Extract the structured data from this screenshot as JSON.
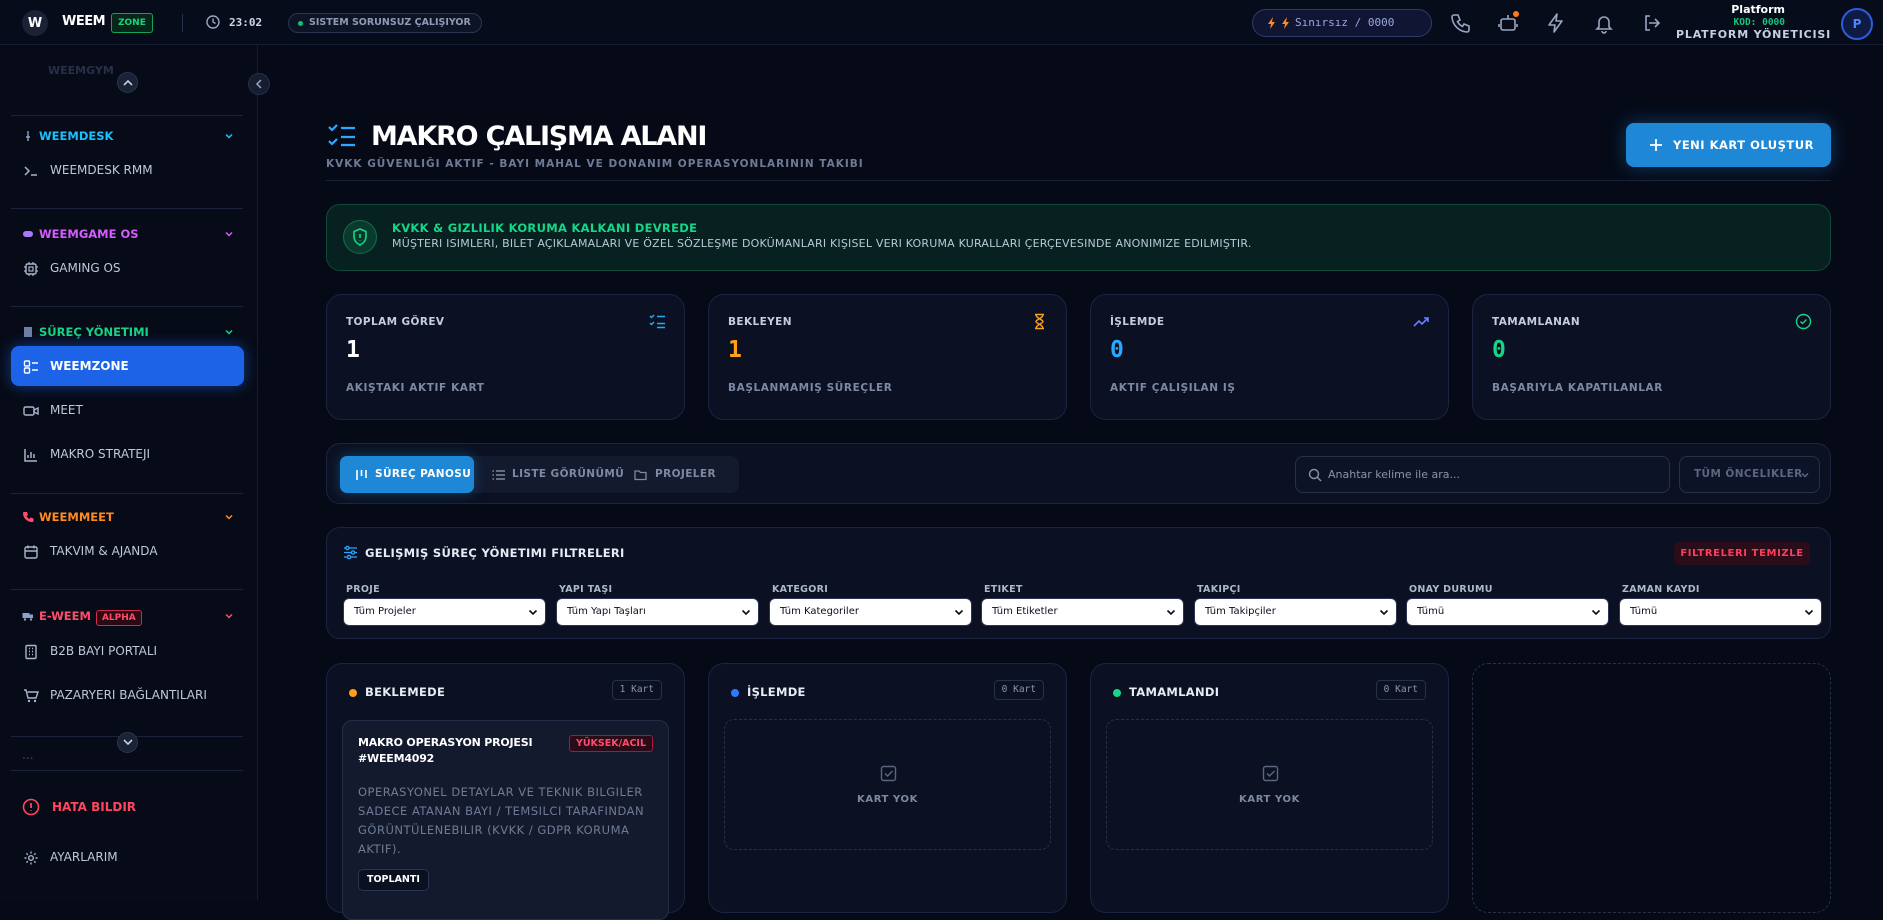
{
  "topbar": {
    "logo_letter": "W",
    "brand": "WEEM",
    "zone_tag": "ZONE",
    "time": "23:02",
    "system_status": "SISTEM SORUNSUZ ÇALIŞIYOR",
    "credit_text": "Sınırsız / 0000",
    "user_name": "Platform",
    "user_code": "KOD: 0000",
    "user_role": "PLATFORM YÖNETICISI",
    "avatar_letter": "P"
  },
  "sidebar": {
    "faded_top": "WEEMGYM",
    "sections": [
      {
        "label": "WEEMDESK",
        "color": "#19c2ff",
        "items": [
          {
            "label": "WEEMDESK RMM"
          }
        ]
      },
      {
        "label": "WEEMGAME OS",
        "color": "#d65cff",
        "items": [
          {
            "label": "GAMING OS"
          }
        ]
      },
      {
        "label": "SÜREÇ YÖNETIMI",
        "color": "#17d486",
        "items": [
          {
            "label": "WEEMZONE"
          },
          {
            "label": "MEET"
          },
          {
            "label": "MAKRO STRATEJI"
          }
        ]
      },
      {
        "label": "WEEMMEET",
        "color": "#ff8a1f",
        "items": [
          {
            "label": "TAKVIM & AJANDA"
          }
        ]
      },
      {
        "label": "E-WEEM",
        "color": "#ff4d6d",
        "badge": "ALPHA",
        "items": [
          {
            "label": "B2B BAYI PORTALI"
          },
          {
            "label": "PAZARYERI BAĞLANTILARI"
          }
        ]
      }
    ],
    "faded_bottom": "...",
    "report_bug": "HATA BILDIR",
    "settings": "AYARLARIM"
  },
  "page": {
    "title": "MAKRO ÇALIŞMA ALANI",
    "subtitle": "KVKK GÜVENLIĞI AKTIF - BAYI MAHAL VE DONANIM OPERASYONLARININ TAKIBI",
    "new_card_button": "YENI KART OLUŞTUR"
  },
  "kvkk": {
    "title": "KVKK & GIZLILIK KORUMA KALKANI DEVREDE",
    "text": "MÜŞTERI ISIMLERI, BILET AÇIKLAMALARI VE ÖZEL SÖZLEŞME DOKÜMANLARI KIŞISEL VERI KORUMA KURALLARI ÇERÇEVESINDE ANONIMIZE EDILMIŞTIR."
  },
  "stats": [
    {
      "label": "TOPLAM GÖREV",
      "value": "1",
      "caption": "AKIŞTAKI AKTIF KART",
      "color": "#ffffff",
      "icon": "list-check-icon"
    },
    {
      "label": "BEKLEYEN",
      "value": "1",
      "caption": "BAŞLANMAMIŞ SÜREÇLER",
      "color": "#ff9f1a",
      "icon": "hourglass-icon"
    },
    {
      "label": "İŞLEMDE",
      "value": "0",
      "caption": "AKTIF ÇALIŞILAN IŞ",
      "color": "#2aa8ff",
      "icon": "trend-up-icon"
    },
    {
      "label": "TAMAMLANAN",
      "value": "0",
      "caption": "BAŞARIYLA KAPATILANLAR",
      "color": "#17d486",
      "icon": "check-circle-icon"
    }
  ],
  "toolbar": {
    "tabs": [
      {
        "label": "SÜREÇ PANOSU"
      },
      {
        "label": "LISTE GÖRÜNÜMÜ"
      },
      {
        "label": "PROJELER"
      }
    ],
    "search_placeholder": "Anahtar kelime ile ara...",
    "priority_select": "TÜM ÖNCELIKLER"
  },
  "filters": {
    "title": "GELIŞMIŞ SÜREÇ YÖNETIMI FILTRELERI",
    "clear": "FILTRELERI TEMIZLE",
    "groups": [
      {
        "label": "PROJE",
        "value": "Tüm Projeler"
      },
      {
        "label": "YAPI TAŞI",
        "value": "Tüm Yapı Taşları"
      },
      {
        "label": "KATEGORI",
        "value": "Tüm Kategoriler"
      },
      {
        "label": "ETIKET",
        "value": "Tüm Etiketler"
      },
      {
        "label": "TAKIPÇI",
        "value": "Tüm Takipçiler"
      },
      {
        "label": "ONAY DURUMU",
        "value": "Tümü"
      },
      {
        "label": "ZAMAN KAYDI",
        "value": "Tümü"
      }
    ]
  },
  "board": {
    "columns": [
      {
        "title": "BEKLEMEDE",
        "count": "1 Kart",
        "color": "#ff9f1a"
      },
      {
        "title": "İŞLEMDE",
        "count": "0 Kart",
        "color": "#2a7bff",
        "empty": "KART YOK"
      },
      {
        "title": "TAMAMLANDI",
        "count": "0 Kart",
        "color": "#17d486",
        "empty": "KART YOK"
      }
    ],
    "task": {
      "title": "MAKRO OPERASYON PROJESI #WEEM4092",
      "priority": "YÜKSEK/ACIL",
      "description": "OPERASYONEL DETAYLAR VE TEKNIK BILGILER SADECE ATANAN BAYI / TEMSILCI TARAFINDAN GÖRÜNTÜLENEBILIR (KVKK / GDPR KORUMA AKTIF).",
      "tag": "TOPLANTI"
    }
  }
}
